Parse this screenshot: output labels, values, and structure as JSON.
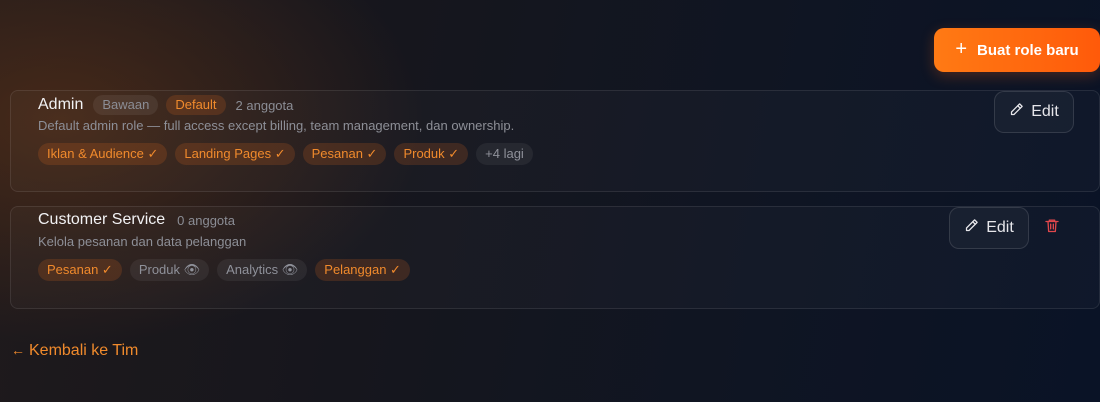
{
  "actions": {
    "create_role_label": "Buat role baru",
    "create_role_icon": "plus-icon",
    "back_link_label": "Kembali ke Tim",
    "back_link_arrow": "←"
  },
  "colors": {
    "accent": "#ff6a10",
    "accent_text": "#f08a2c",
    "danger": "#e0474c"
  },
  "roles": [
    {
      "name": "Admin",
      "badges": [
        "Bawaan",
        "Default"
      ],
      "members": "2 anggota",
      "description": "Default admin role — full access except billing, team management, dan ownership.",
      "permissions": [
        {
          "label": "Iklan & Audience ✓",
          "enabled": true
        },
        {
          "label": "Landing Pages ✓",
          "enabled": true
        },
        {
          "label": "Pesanan ✓",
          "enabled": true
        },
        {
          "label": "Produk ✓",
          "enabled": true
        },
        {
          "label": "+4 lagi",
          "enabled": false
        }
      ],
      "edit_label": "Edit",
      "edit_icon": "pencil-icon"
    },
    {
      "name": "Customer Service",
      "members": "0 anggota",
      "description": "Kelola pesanan dan data pelanggan",
      "permissions": [
        {
          "label": "Pesanan ✓",
          "enabled": true
        },
        {
          "label": "Produk 👁",
          "enabled": false
        },
        {
          "label": "Analytics 👁",
          "enabled": false
        },
        {
          "label": "Pelanggan ✓",
          "enabled": true
        }
      ],
      "edit_label": "Edit",
      "edit_icon": "pencil-icon",
      "delete_icon": "trash-icon"
    }
  ]
}
